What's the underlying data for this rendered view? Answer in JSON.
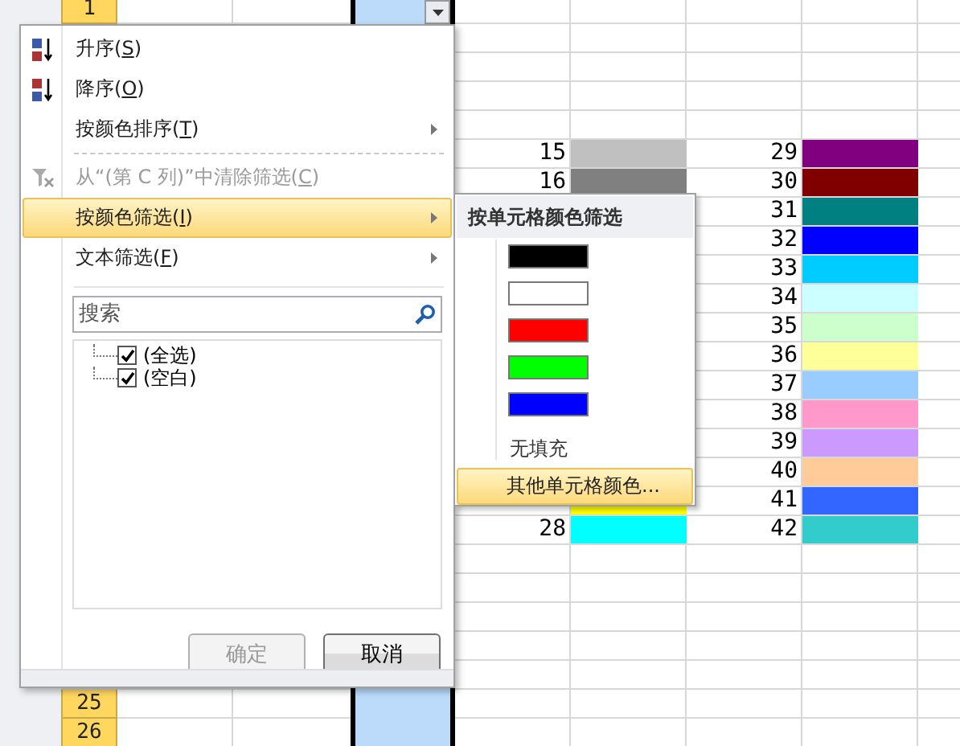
{
  "sheet": {
    "row_headers": [
      {
        "label": "1"
      },
      {
        "label": "25"
      },
      {
        "label": "26"
      }
    ],
    "color_rows": [
      {
        "left": {
          "value": "15",
          "color": "#c0c0c0"
        },
        "right": {
          "value": "29",
          "color": "#800080"
        }
      },
      {
        "left": {
          "value": "16",
          "color": "#808080"
        },
        "right": {
          "value": "30",
          "color": "#800000"
        }
      },
      {
        "right": {
          "value": "31",
          "color": "#008080"
        }
      },
      {
        "right": {
          "value": "32",
          "color": "#0000ff"
        }
      },
      {
        "right": {
          "value": "33",
          "color": "#00ccff"
        }
      },
      {
        "right": {
          "value": "34",
          "color": "#ccffff"
        }
      },
      {
        "right": {
          "value": "35",
          "color": "#ccffcc"
        }
      },
      {
        "right": {
          "value": "36",
          "color": "#ffff99"
        }
      },
      {
        "right": {
          "value": "37",
          "color": "#99ccff"
        }
      },
      {
        "right": {
          "value": "38",
          "color": "#ff99cc"
        }
      },
      {
        "right": {
          "value": "39",
          "color": "#cc99ff"
        }
      },
      {
        "right": {
          "value": "40",
          "color": "#ffcc99"
        }
      },
      {
        "left": {
          "color": "#ffff00"
        },
        "right": {
          "value": "41",
          "color": "#3366ff"
        }
      },
      {
        "left": {
          "value": "28",
          "color": "#00ffff"
        },
        "right": {
          "value": "42",
          "color": "#33cccc"
        }
      }
    ]
  },
  "filter_menu": {
    "items": [
      {
        "kind": "sort_ascending",
        "label": "升序(",
        "access_key": "S",
        "label_end": ")",
        "disabled": false,
        "selected": false,
        "submenu": false
      },
      {
        "kind": "sort_descending",
        "label": "降序(",
        "access_key": "O",
        "label_end": ")",
        "disabled": false,
        "selected": false,
        "submenu": false
      },
      {
        "kind": "plain",
        "label": "按颜色排序(",
        "access_key": "T",
        "label_end": ")",
        "disabled": false,
        "selected": false,
        "submenu": true
      },
      {
        "kind": "clear_filter",
        "label": "从“(第 C 列)”中清除筛选(",
        "access_key": "C",
        "label_end": ")",
        "disabled": true,
        "selected": false,
        "submenu": false
      },
      {
        "kind": "plain",
        "label": "按颜色筛选(",
        "access_key": "I",
        "label_end": ")",
        "disabled": false,
        "selected": true,
        "submenu": true
      },
      {
        "kind": "plain",
        "label": "文本筛选(",
        "access_key": "F",
        "label_end": ")",
        "disabled": false,
        "selected": false,
        "submenu": true
      }
    ],
    "search": {
      "placeholder": "搜索"
    },
    "values": [
      {
        "label": "(全选)",
        "checked": true
      },
      {
        "label": "(空白)",
        "checked": true
      }
    ],
    "buttons": [
      {
        "label": "确定",
        "disabled": true
      },
      {
        "label": "取消",
        "disabled": false
      }
    ]
  },
  "color_submenu": {
    "title": "按单元格颜色筛选",
    "swatches": [
      {
        "color": "#000000"
      },
      {
        "color": "#ffffff"
      },
      {
        "color": "#ff0000"
      },
      {
        "color": "#00ff00"
      },
      {
        "color": "#0000ff"
      }
    ],
    "no_fill": "无填充",
    "more": {
      "label": "其他单元格颜色...",
      "selected": true
    }
  }
}
